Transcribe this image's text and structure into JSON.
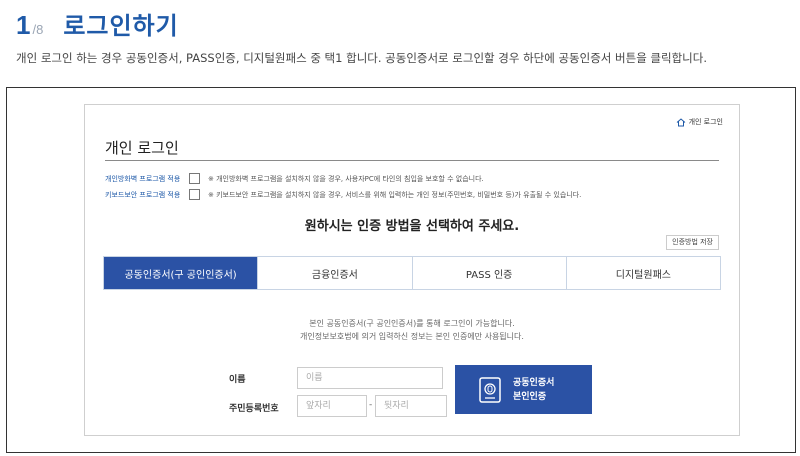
{
  "step": {
    "number": "1",
    "total": "/8",
    "heading": "로그인하기"
  },
  "description": "개인 로그인 하는 경우 공동인증서, PASS인증, 디지털원패스 중 택1 합니다. 공동인증서로 로그인할 경우 하단에 공동인증서 버튼을 클릭합니다.",
  "card": {
    "home_label": "개인 로그인",
    "title": "개인 로그인",
    "options": [
      {
        "label": "개인방화벽 프로그램 적용",
        "note": "※ 개인방화벽 프로그램을 설치하지 않을 경우, 사용자PC에 타인의 침입을 보호할 수 없습니다."
      },
      {
        "label": "키보드보안 프로그램 적용",
        "note": "※ 키보드보안 프로그램을 설치하지 않을 경우, 서비스를 위해 입력하는 개인 정보(주민번호, 비밀번호 등)가 유출될 수 있습니다."
      }
    ],
    "select_title": "원하시는 인증 방법을 선택하여 주세요.",
    "save_method": "인증방법 저장",
    "tabs": [
      {
        "label": "공동인증서(구 공인인증서)"
      },
      {
        "label": "금융인증서"
      },
      {
        "label": "PASS 인증"
      },
      {
        "label": "디지털원패스"
      }
    ],
    "info_line1": "본인 공동인증서(구 공인인증서)를 통해 로그인이 가능합니다.",
    "info_line2": "개인정보보호법에 의거 입력하신 정보는 본인 인증에만 사용됩니다.",
    "name_label": "이름",
    "name_placeholder": "이름",
    "rrn_label": "주민등록번호",
    "rrn_front_placeholder": "앞자리",
    "rrn_dash": "-",
    "rrn_back_placeholder": "뒷자리",
    "cert_button_line1": "공동인증서",
    "cert_button_line2": "본인인증"
  },
  "colors": {
    "accent": "#2b52a5",
    "heading": "#1f5aa8"
  },
  "icons": {
    "home": "home-icon",
    "certificate": "certificate-icon"
  }
}
